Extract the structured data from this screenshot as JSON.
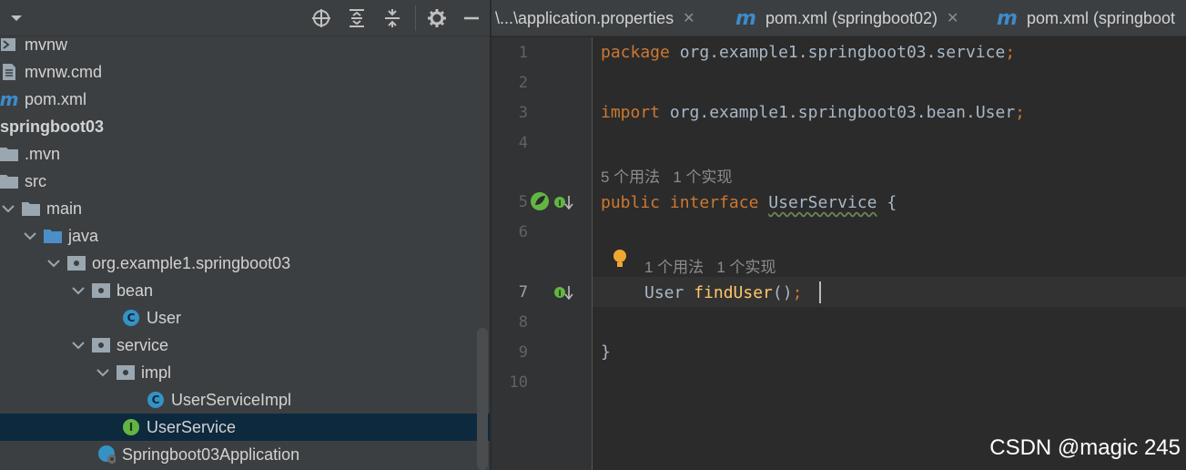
{
  "toolbar": {
    "icons": [
      "chevron-down-icon",
      "crosshair-icon",
      "expand-all-icon",
      "collapse-all-icon",
      "gear-icon",
      "minimize-icon"
    ]
  },
  "tree": {
    "items": [
      {
        "label": "mvnw",
        "icon": "terminal-file-icon"
      },
      {
        "label": "mvnw.cmd",
        "icon": "text-file-icon"
      },
      {
        "label": "pom.xml",
        "icon": "maven-icon"
      },
      {
        "label": "springboot03",
        "icon": "module-icon"
      },
      {
        "label": ".mvn",
        "icon": "folder-icon"
      },
      {
        "label": "src",
        "icon": "folder-icon"
      },
      {
        "label": "main",
        "icon": "folder-icon"
      },
      {
        "label": "java",
        "icon": "source-folder-icon"
      },
      {
        "label": "org.example1.springboot03",
        "icon": "package-icon"
      },
      {
        "label": "bean",
        "icon": "package-icon"
      },
      {
        "label": "User",
        "icon": "class-icon"
      },
      {
        "label": "service",
        "icon": "package-icon"
      },
      {
        "label": "impl",
        "icon": "package-icon"
      },
      {
        "label": "UserServiceImpl",
        "icon": "class-icon"
      },
      {
        "label": "UserService",
        "icon": "interface-icon"
      },
      {
        "label": "Springboot03Application",
        "icon": "spring-boot-class-icon"
      }
    ],
    "selected": "UserService"
  },
  "tabs": [
    {
      "label": "\\...\\application.properties",
      "icon": ""
    },
    {
      "label": "pom.xml (springboot02)",
      "icon": "maven-icon"
    },
    {
      "label": "pom.xml (springboot",
      "icon": "maven-icon"
    }
  ],
  "editor": {
    "line_numbers": [
      "1",
      "2",
      "3",
      "4",
      "5",
      "6",
      "7",
      "8",
      "9",
      "10"
    ],
    "current_line": "7",
    "code": {
      "l1_kw": "package",
      "l1_rest": " org.example1.springboot03.service",
      "l1_semi": ";",
      "l3_kw": "import",
      "l3_rest": " org.example1.springboot03.bean.User",
      "l3_semi": ";",
      "l5_kw1": "public",
      "l5_kw2": "interface",
      "l5_name": "UserService",
      "l5_brace": " {",
      "l7_type": "User ",
      "l7_fn": "findUser",
      "l7_parens": "()",
      "l7_semi": ";",
      "l9_brace": "}"
    },
    "hints": {
      "interface_usages": "5 个用法",
      "interface_impls": "1 个实现",
      "method_usages": "1 个用法",
      "method_impls": "1 个实现"
    }
  },
  "watermark": "CSDN @magic 245",
  "colors": {
    "keyword": "#cc7832",
    "function": "#ffc66d",
    "selection": "#0d293e",
    "maven": "#3d8bcd"
  }
}
